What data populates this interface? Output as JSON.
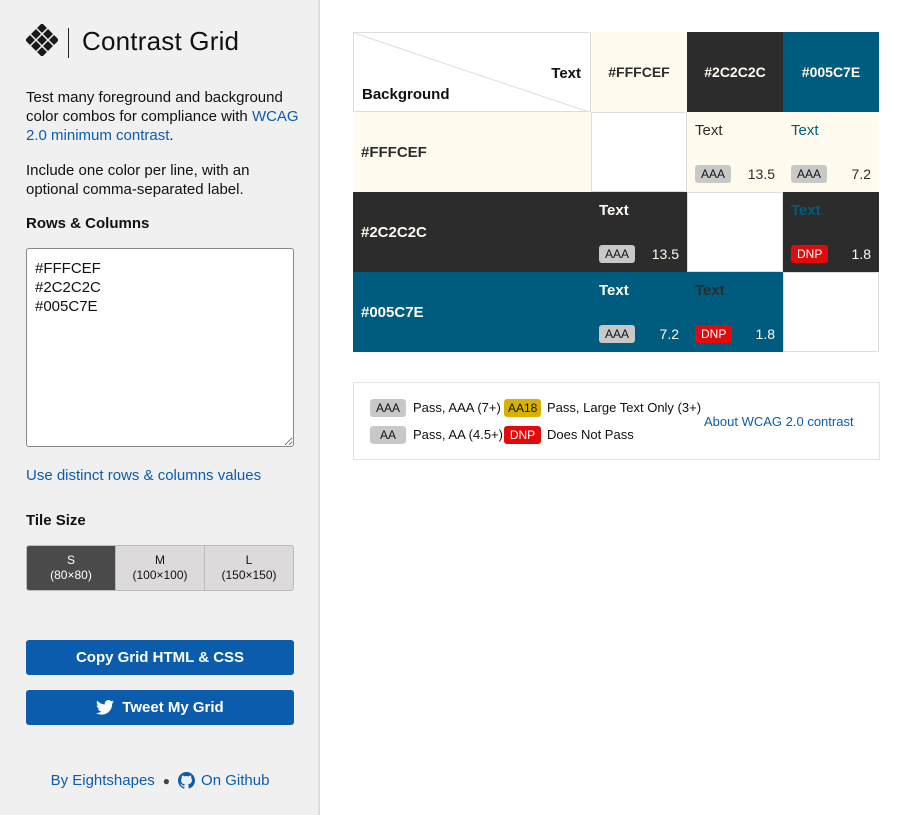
{
  "app": {
    "title": "Contrast Grid"
  },
  "sidebar": {
    "description": "Test many foreground and background color combos for compliance with",
    "description_link": "WCAG 2.0 minimum contrast",
    "description_end": ".",
    "instructions": "Include one color per line, with an optional comma-separated label.",
    "rows_columns_label": "Rows & Columns",
    "colors_value": "#FFFCEF\n#2C2C2C\n#005C7E",
    "distinct_link": "Use distinct rows & columns values",
    "tile_size_label": "Tile Size",
    "tile_sizes": [
      {
        "label": "S",
        "dims": "(80×80)",
        "active": true
      },
      {
        "label": "M",
        "dims": "(100×100)",
        "active": false
      },
      {
        "label": "L",
        "dims": "(150×150)",
        "active": false
      }
    ],
    "copy_button": "Copy Grid HTML & CSS",
    "tweet_button": "Tweet My Grid",
    "footer_by": "By Eightshapes",
    "footer_github": "On Github"
  },
  "grid": {
    "corner_text": "Text",
    "corner_background": "Background",
    "colors": [
      "#FFFCEF",
      "#2C2C2C",
      "#005C7E"
    ],
    "text_colors": [
      "#2C2C2C",
      "#FFFCEF",
      "#FFFCEF"
    ],
    "tiles": [
      [
        null,
        {
          "text": "Text",
          "badge": "AAA",
          "ratio": "13.5"
        },
        {
          "text": "Text",
          "badge": "AAA",
          "ratio": "7.2"
        }
      ],
      [
        {
          "text": "Text",
          "badge": "AAA",
          "ratio": "13.5"
        },
        null,
        {
          "text": "Text",
          "badge": "DNP",
          "ratio": "1.8"
        }
      ],
      [
        {
          "text": "Text",
          "badge": "AAA",
          "ratio": "7.2"
        },
        {
          "text": "Text",
          "badge": "DNP",
          "ratio": "1.8"
        },
        null
      ]
    ]
  },
  "legend": {
    "aaa_badge": "AAA",
    "aaa_text": "Pass, AAA (7+)",
    "aa18_badge": "AA18",
    "aa18_text": "Pass, Large Text Only (3+)",
    "aa_badge": "AA",
    "aa_text": "Pass, AA (4.5+)",
    "dnp_badge": "DNP",
    "dnp_text": "Does Not Pass",
    "about_link": "About WCAG 2.0 contrast"
  }
}
